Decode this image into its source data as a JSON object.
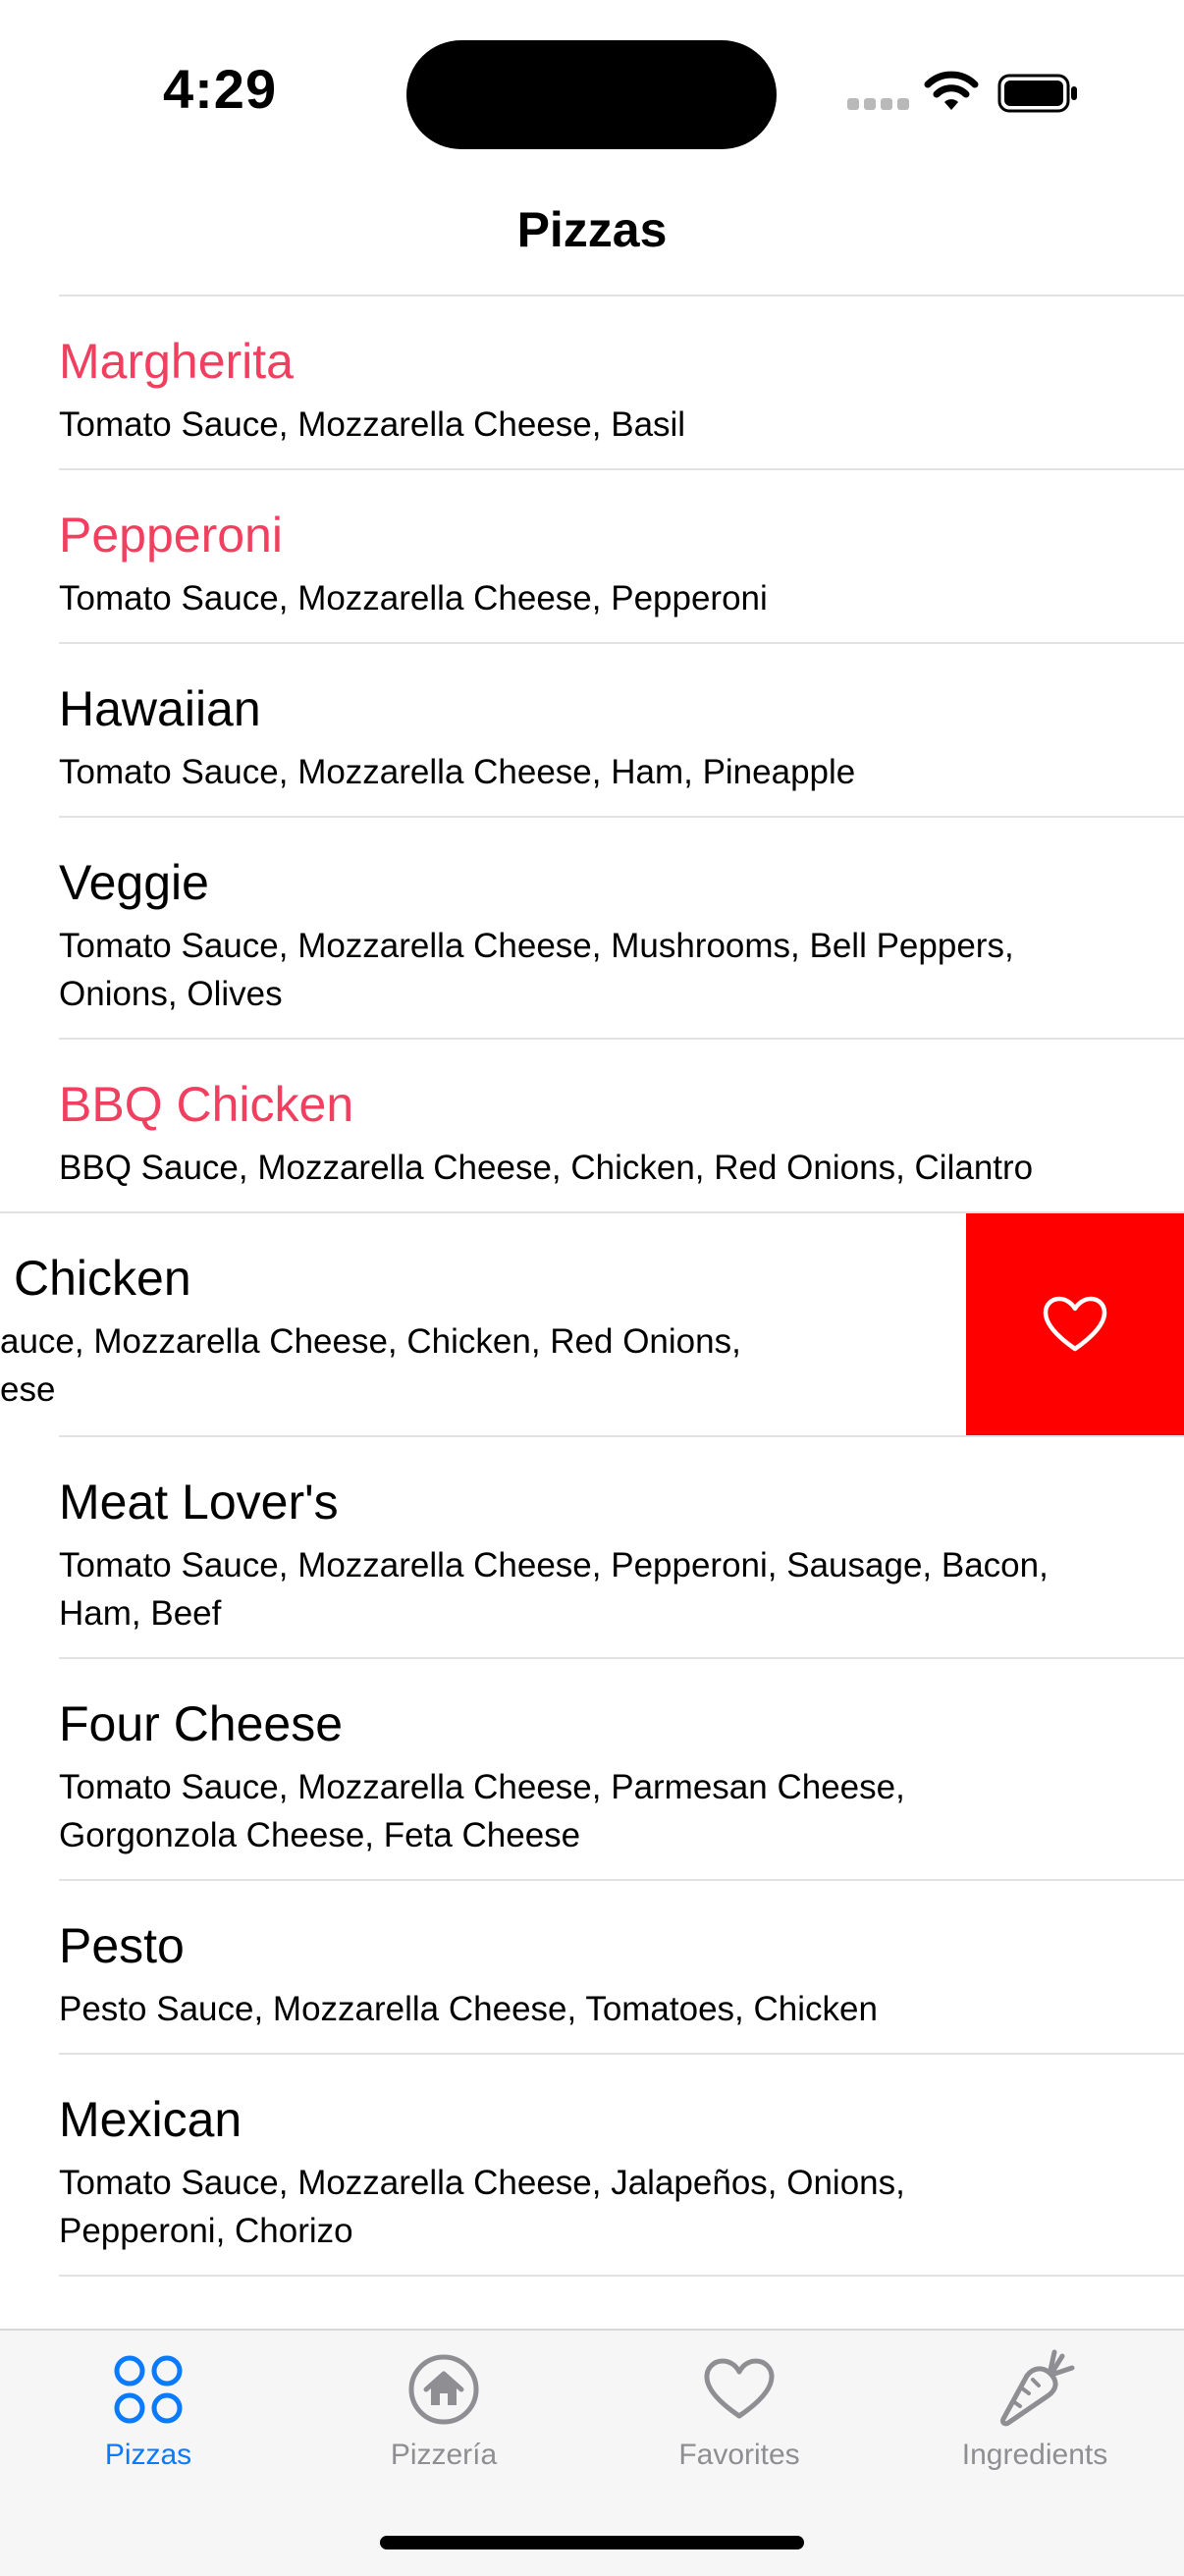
{
  "status": {
    "time": "4:29"
  },
  "nav": {
    "title": "Pizzas"
  },
  "pizzas": [
    {
      "name": "Margherita",
      "ingredients": "Tomato Sauce, Mozzarella Cheese, Basil",
      "favorite": true
    },
    {
      "name": "Pepperoni",
      "ingredients": "Tomato Sauce, Mozzarella Cheese, Pepperoni",
      "favorite": true
    },
    {
      "name": "Hawaiian",
      "ingredients": "Tomato Sauce, Mozzarella Cheese, Ham, Pineapple",
      "favorite": false
    },
    {
      "name": "Veggie",
      "ingredients": "Tomato Sauce, Mozzarella Cheese, Mushrooms, Bell Peppers, Onions, Olives",
      "favorite": false
    },
    {
      "name": "BBQ Chicken",
      "ingredients": "BBQ Sauce, Mozzarella Cheese, Chicken, Red Onions, Cilantro",
      "favorite": true
    },
    {
      "name": "Chicken",
      "ingredients": "auce, Mozzarella Cheese, Chicken, Red Onions,",
      "ingredients_line2": "ese",
      "favorite": false,
      "swiped": true
    },
    {
      "name": "Meat Lover's",
      "ingredients": "Tomato Sauce, Mozzarella Cheese, Pepperoni, Sausage, Bacon, Ham, Beef",
      "favorite": false
    },
    {
      "name": "Four Cheese",
      "ingredients": "Tomato Sauce, Mozzarella Cheese, Parmesan Cheese, Gorgonzola Cheese, Feta Cheese",
      "favorite": false
    },
    {
      "name": "Pesto",
      "ingredients": "Pesto Sauce, Mozzarella Cheese, Tomatoes, Chicken",
      "favorite": false
    },
    {
      "name": "Mexican",
      "ingredients": "Tomato Sauce, Mozzarella Cheese, Jalapeños, Onions, Pepperoni, Chorizo",
      "favorite": false
    }
  ],
  "swipe_action": {
    "icon": "heart-icon",
    "color": "#ff0000"
  },
  "tabs": [
    {
      "label": "Pizzas",
      "icon": "pizzas-grid-icon",
      "active": true
    },
    {
      "label": "Pizzería",
      "icon": "home-icon",
      "active": false
    },
    {
      "label": "Favorites",
      "icon": "heart-icon",
      "active": false
    },
    {
      "label": "Ingredients",
      "icon": "carrot-icon",
      "active": false
    }
  ],
  "colors": {
    "favorite": "#f13f5f",
    "accent": "#0a7aff",
    "inactive": "#8e8e93"
  }
}
